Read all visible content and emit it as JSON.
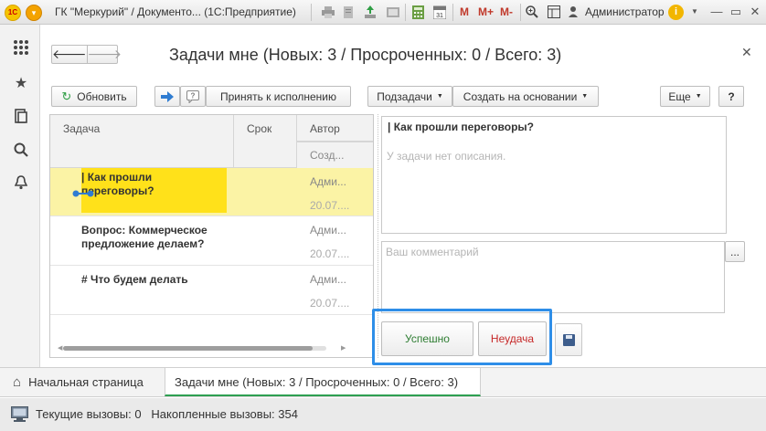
{
  "titlebar": {
    "logo": "1С",
    "title": "ГК \"Меркурий\" / Документо... (1С:Предприятие)",
    "m": "M",
    "m_plus": "M+",
    "m_minus": "M-",
    "user": "Администратор",
    "info": "i"
  },
  "form": {
    "title": "Задачи мне (Новых: 3 / Просроченных: 0 / Всего: 3)"
  },
  "toolbar": {
    "refresh": "Обновить",
    "accept": "Принять к исполнению",
    "subtasks": "Подзадачи",
    "create_based": "Создать на основании",
    "more": "Еще",
    "help": "?"
  },
  "table": {
    "columns": {
      "task": "Задача",
      "deadline": "Срок",
      "author": "Автор",
      "created": "Созд..."
    },
    "rows": [
      {
        "title_line1": "| Как прошли переговоры?",
        "title_line2": "",
        "author": "Адми...",
        "date": "20.07...."
      },
      {
        "title_line1": "Вопрос: Коммерческое",
        "title_line2": "предложение делаем?",
        "author": "Адми...",
        "date": "20.07...."
      },
      {
        "title_line1": "# Что будем делать",
        "title_line2": "",
        "author": "Адми...",
        "date": "20.07...."
      }
    ]
  },
  "details": {
    "task_title": "| Как прошли переговоры?",
    "no_description": "У задачи нет описания.",
    "comment_placeholder": "Ваш комментарий",
    "success": "Успешно",
    "failure": "Неудача",
    "more": "..."
  },
  "tabs": {
    "home": "Начальная страница",
    "active": "Задачи мне (Новых: 3 / Просроченных: 0 / Всего: 3)"
  },
  "status": {
    "text": "Текущие вызовы: 0   Накопленные вызовы: 354"
  }
}
